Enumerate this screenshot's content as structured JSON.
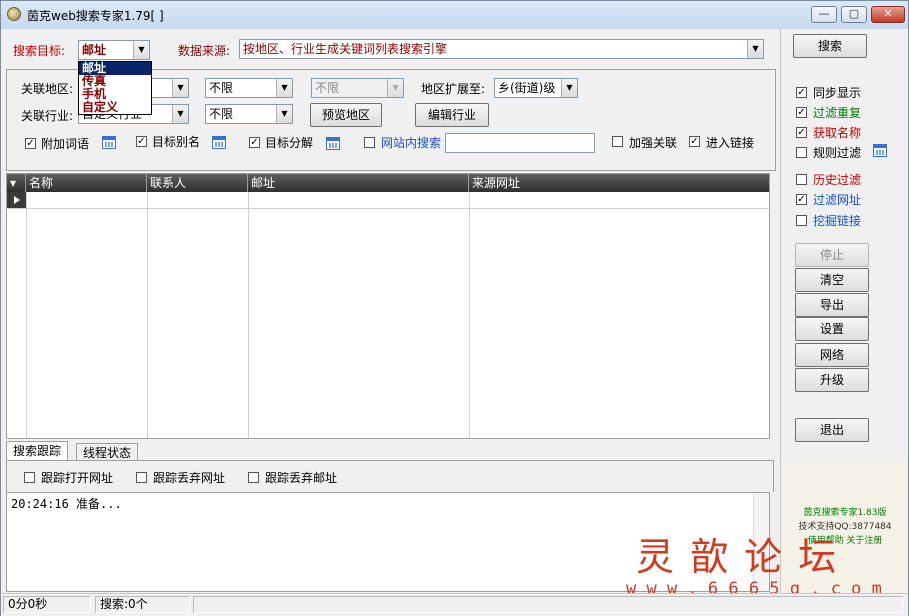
{
  "window": {
    "title": "茵克web搜索专家1.79[    ]",
    "minimize_glyph": "—",
    "maximize_glyph": "▢",
    "close_glyph": "✕"
  },
  "search_target": {
    "label": "搜索目标:",
    "value": "邮址",
    "options": [
      "邮址",
      "传真",
      "手机",
      "自定义"
    ]
  },
  "data_source": {
    "label": "数据来源:",
    "value": "按地区、行业生成关键词列表搜索引擎"
  },
  "filters": {
    "region_label": "关联地区:",
    "region_value": "",
    "region_sub1": "不限",
    "region_sub2": "不限",
    "expand_label": "地区扩展至:",
    "expand_value": "乡(街道)级",
    "industry_label": "关联行业:",
    "industry_value": "自定义行业",
    "industry_sub": "不限",
    "preview_region_button": "预览地区",
    "edit_industry_button": "编辑行业"
  },
  "options_row": {
    "append_keywords": {
      "label": "附加词语",
      "checked": true
    },
    "target_alias": {
      "label": "目标别名",
      "checked": true
    },
    "target_split": {
      "label": "目标分解",
      "checked": true
    },
    "site_search": {
      "label": "网站内搜索",
      "checked": false,
      "value": ""
    },
    "strong_link": {
      "label": "加强关联",
      "checked": false
    },
    "enter_link": {
      "label": "进入链接",
      "checked": true
    }
  },
  "grid": {
    "columns": [
      "名称",
      "联系人",
      "邮址",
      "来源网址"
    ],
    "rows": []
  },
  "tabs": {
    "items": [
      "搜索跟踪",
      "线程状态"
    ],
    "active": "搜索跟踪"
  },
  "tracking": {
    "open_url": {
      "label": "跟踪打开网址",
      "checked": false
    },
    "drop_url": {
      "label": "跟踪丢弃网址",
      "checked": false
    },
    "drop_email": {
      "label": "跟踪丢弃邮址",
      "checked": false
    }
  },
  "log": {
    "lines": [
      "20:24:16 准备..."
    ]
  },
  "sidebar": {
    "search_button": "搜索",
    "sync_display": {
      "label": "同步显示",
      "checked": true
    },
    "filter_duplicate": {
      "label": "过滤重复",
      "checked": true
    },
    "get_name": {
      "label": "获取名称",
      "checked": true
    },
    "rule_filter": {
      "label": "规则过滤",
      "checked": false
    },
    "history_filter": {
      "label": "历史过滤",
      "checked": false
    },
    "filter_url": {
      "label": "过滤网址",
      "checked": true
    },
    "mine_links": {
      "label": "挖掘链接",
      "checked": false
    },
    "stop_button": "停止",
    "clear_button": "清空",
    "export_button": "导出",
    "settings_button": "设置",
    "network_button": "网络",
    "upgrade_button": "升级",
    "exit_button": "退出"
  },
  "ad_panel": {
    "line1": "茵克搜索专家1.83版",
    "line2": "技术支持QQ:3877484",
    "line3": "使用帮助  关于注册"
  },
  "watermark": {
    "title": "灵 歆 论 坛",
    "url": "w w w . 6 6 6 5 q . c o m"
  },
  "status": {
    "elapsed": "0分0秒",
    "search_count": "搜索:0个"
  },
  "colors": {
    "title_bar": "#c7daf0",
    "label_red": "#c00000",
    "link_blue": "#1a4fc0",
    "grid_header": "#3a3a3a",
    "dropdown_selected": "#0a246a",
    "watermark": "#d23a1e"
  }
}
